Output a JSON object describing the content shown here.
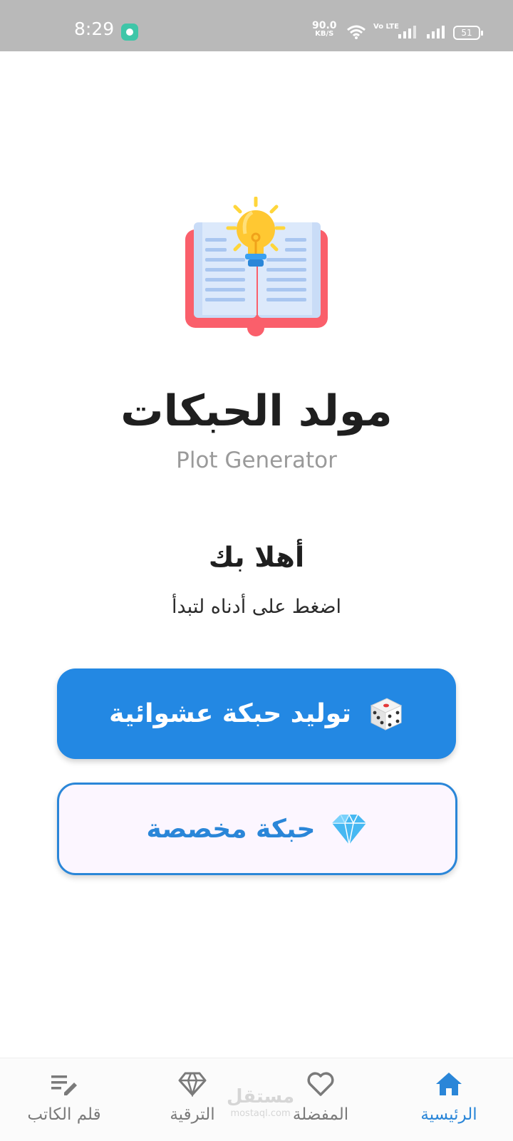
{
  "status_bar": {
    "time": "8:29",
    "net_speed": "90.0",
    "net_speed_unit": "KB/S",
    "volte": "Vo LTE",
    "battery": "51"
  },
  "header": {
    "app_title": "مولد الحبكات",
    "app_subtitle": "Plot Generator",
    "hero_icon": "book-lightbulb-icon"
  },
  "welcome": {
    "title": "أهلا بك",
    "subtitle": "اضغط على أدناه لتبدأ"
  },
  "actions": {
    "random_label": "توليد حبكة عشوائية",
    "random_icon": "dice-icon",
    "custom_label": "حبكة مخصصة",
    "custom_icon": "diamond-icon"
  },
  "bottom_nav": {
    "items": [
      {
        "label": "الرئيسية",
        "icon": "home-icon",
        "active": true
      },
      {
        "label": "المفضلة",
        "icon": "heart-icon",
        "active": false
      },
      {
        "label": "الترقية",
        "icon": "diamond-icon",
        "active": false
      },
      {
        "label": "قلم الكاتب",
        "icon": "pen-icon",
        "active": false
      }
    ]
  },
  "watermark": {
    "text": "مستقل",
    "sub": "mostaql.com"
  },
  "colors": {
    "primary": "#2388e3",
    "accent_text": "#2a86d8",
    "status_bar": "#b9b9b9",
    "custom_button_bg": "#fcf6ff"
  }
}
